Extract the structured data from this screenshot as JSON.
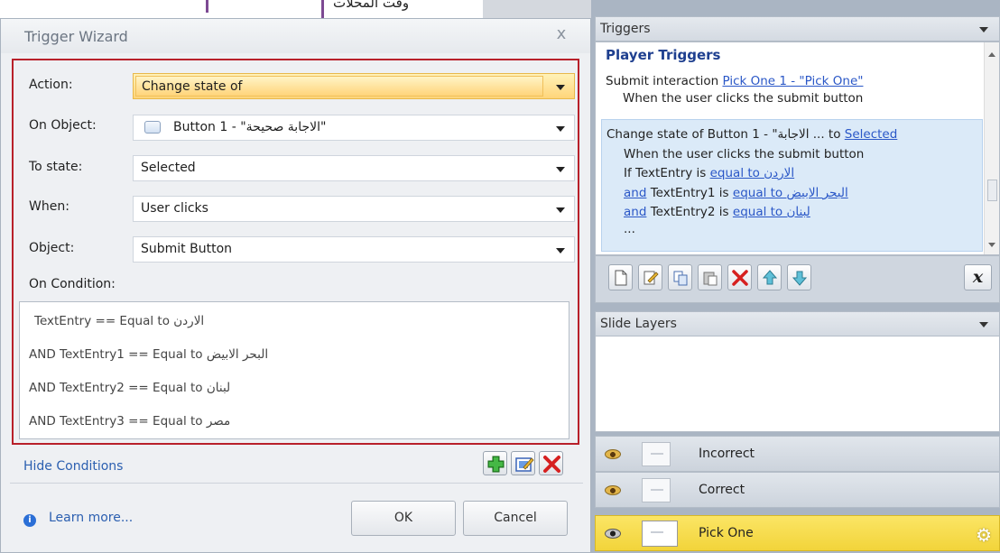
{
  "background": {
    "arabic_text": "وقت المحلات"
  },
  "wizard": {
    "title": "Trigger Wizard",
    "close_glyph": "x",
    "fields": {
      "action": {
        "label": "Action:",
        "value": "Change state of"
      },
      "on_object": {
        "label": "On Object:",
        "value": "Button 1 - \"الاجابة صحيحة\""
      },
      "to_state": {
        "label": "To state:",
        "value": "Selected"
      },
      "when": {
        "label": "When:",
        "value": "User clicks"
      },
      "object": {
        "label": "Object:",
        "value": "Submit Button"
      }
    },
    "on_condition_label": "On Condition:",
    "conditions": [
      "TextEntry == Equal to الاردن",
      "AND TextEntry1 == Equal to البحر الابيض",
      "AND TextEntry2 == Equal to لبنان",
      "AND TextEntry3 == Equal to مصر"
    ],
    "hide_conditions": "Hide Conditions",
    "learn_more": "Learn more...",
    "ok": "OK",
    "cancel": "Cancel"
  },
  "triggers_panel": {
    "header": "Triggers",
    "section_title": "Player Triggers",
    "trigger1": {
      "prefix": "Submit interaction ",
      "link": "Pick One 1 - \"Pick One\"",
      "sub": "When the user clicks the submit button"
    },
    "trigger2": {
      "prefix": "Change state of Button 1 - \"الاجابة ... to ",
      "link": "Selected",
      "sub": "When the user clicks the submit button",
      "c1_prefix": "If TextEntry is ",
      "c1_link": "equal to الاردن",
      "c2_and": "and",
      "c2_mid": " TextEntry1 is ",
      "c2_link": "equal to البحر الابيض",
      "c3_and": "and",
      "c3_mid": " TextEntry2 is ",
      "c3_link": "equal to لبنان",
      "ellipsis": "..."
    },
    "variable_button": "x"
  },
  "layers_panel": {
    "header": "Slide Layers",
    "layers": [
      "Incorrect",
      "Correct",
      "Pick One"
    ]
  },
  "colors": {
    "highlight_border": "#b8202a",
    "link": "#2a57c7",
    "active_layer": "#f2d43a"
  }
}
